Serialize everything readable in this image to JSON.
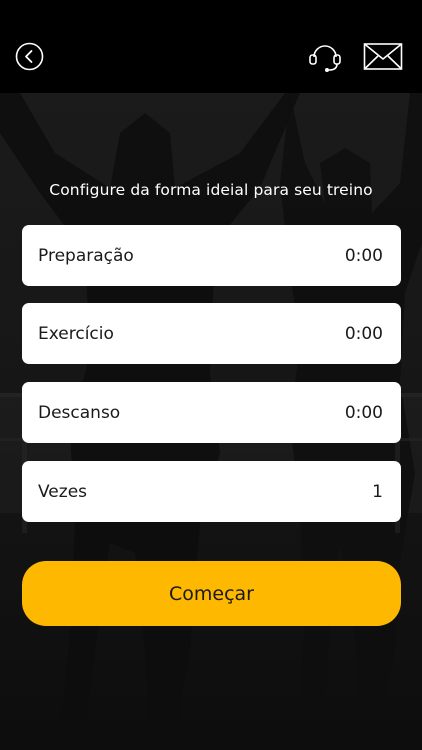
{
  "header": {
    "back_icon": "chevron-left-circle-icon",
    "support_icon": "headset-icon",
    "mail_icon": "envelope-icon"
  },
  "subtitle": "Configure da forma ideial para seu treino",
  "settings": [
    {
      "label": "Preparação",
      "value": "0:00"
    },
    {
      "label": "Exercício",
      "value": "0:00"
    },
    {
      "label": "Descanso",
      "value": "0:00"
    },
    {
      "label": "Vezes",
      "value": "1"
    }
  ],
  "start_label": "Começar",
  "colors": {
    "accent": "#ffb800",
    "topbar": "#000000",
    "card": "#ffffff"
  }
}
